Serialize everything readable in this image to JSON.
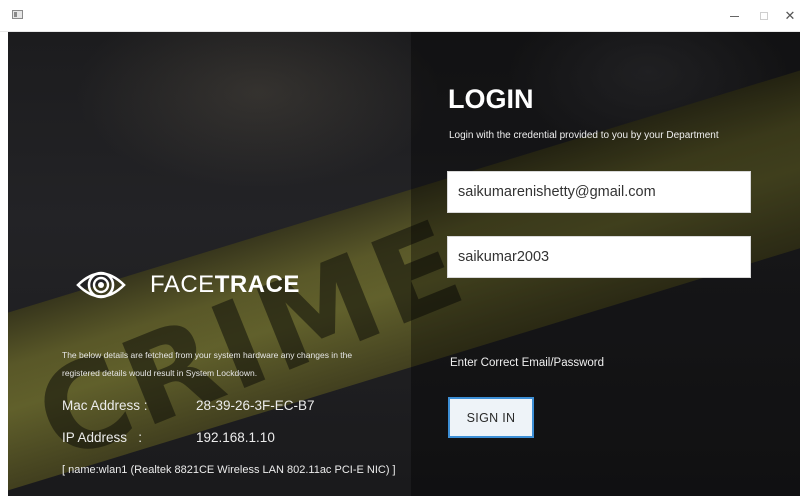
{
  "window": {
    "minimize_glyph": "",
    "maximize_glyph": "",
    "close_glyph": "✕"
  },
  "brand": {
    "name_regular": "FACE",
    "name_bold": "TRACE",
    "logo_icon": "eye-target-icon"
  },
  "hardware": {
    "note": "The below details are fetched from your system hardware any changes in the registered details would result in System Lockdown.",
    "mac_label": "Mac Address :",
    "mac_value": "28-39-26-3F-EC-B7",
    "ip_label": "IP Address   :",
    "ip_value": "192.168.1.10",
    "nic": "[ name:wlan1 (Realtek 8821CE Wireless LAN 802.11ac PCI-E NIC) ]"
  },
  "login": {
    "title": "LOGIN",
    "subtitle": "Login with the credential provided to you by your Department",
    "email_value": "saikumarenishetty@gmail.com",
    "password_value": "saikumar2003",
    "status": "Enter Correct Email/Password",
    "signin_label": "SIGN IN"
  },
  "colors": {
    "accent": "#3d8fd6",
    "background": "#1c1c1e",
    "tape": "#77762f"
  }
}
